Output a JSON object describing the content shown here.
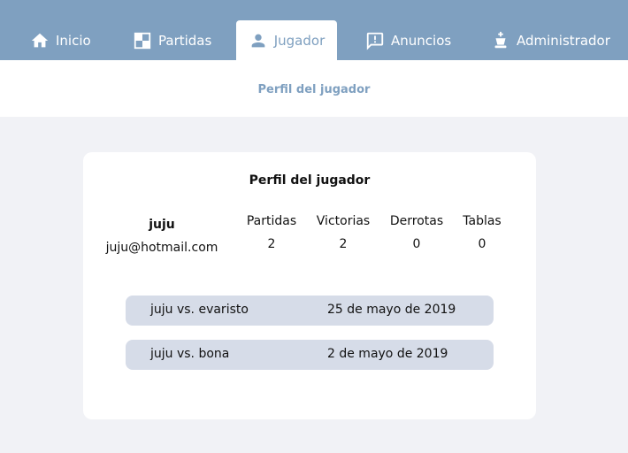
{
  "nav": {
    "items": [
      {
        "label": "Inicio",
        "icon": "home-icon",
        "active": false
      },
      {
        "label": "Partidas",
        "icon": "chessboard-icon",
        "active": false
      },
      {
        "label": "Jugador",
        "icon": "user-icon",
        "active": true
      },
      {
        "label": "Anuncios",
        "icon": "announcement-icon",
        "active": false
      },
      {
        "label": "Administrador",
        "icon": "king-icon",
        "active": false
      }
    ]
  },
  "subheader": {
    "title": "Perfil del jugador"
  },
  "profile": {
    "title": "Perfil del jugador",
    "username": "juju",
    "email": "juju@hotmail.com",
    "stats": [
      {
        "label": "Partidas",
        "value": "2"
      },
      {
        "label": "Victorias",
        "value": "2"
      },
      {
        "label": "Derrotas",
        "value": "0"
      },
      {
        "label": "Tablas",
        "value": "0"
      }
    ],
    "matches": [
      {
        "players": "juju vs. evaristo",
        "date": "25 de mayo de 2019"
      },
      {
        "players": "juju vs. bona",
        "date": "2 de mayo de 2019"
      }
    ]
  },
  "colors": {
    "nav_bg": "#7fa0c0",
    "page_bg": "#f1f2f6",
    "row_bg": "#d6dce8"
  }
}
